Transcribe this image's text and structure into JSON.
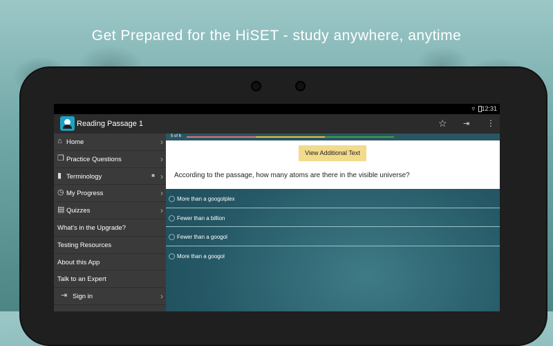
{
  "headline": "Get Prepared for the HiSET - study anywhere, anytime",
  "statusbar": {
    "time": "12:31",
    "wifi_icon": "wifi-icon",
    "battery_icon": "battery-icon"
  },
  "actionbar": {
    "title": "Reading Passage 1",
    "icons": [
      "star-icon",
      "sign-in-icon",
      "overflow-menu-icon"
    ]
  },
  "drawer": {
    "items": [
      {
        "label": "Home",
        "icon": "home-icon",
        "chevron": true
      },
      {
        "label": "Practice Questions",
        "icon": "copy-icon",
        "chevron": true
      },
      {
        "label": "Terminology",
        "icon": "book-icon",
        "chevron": true,
        "locked": true
      },
      {
        "label": "My Progress",
        "icon": "progress-icon",
        "chevron": true
      },
      {
        "label": "Quizzes",
        "icon": "quiz-icon",
        "chevron": true
      },
      {
        "label": "What's in the Upgrade?"
      },
      {
        "label": "Testing Resources"
      },
      {
        "label": "About this App"
      },
      {
        "label": "Talk to an Expert"
      },
      {
        "label": "Sign in",
        "icon": "sign-in-icon",
        "chevron": true
      }
    ]
  },
  "question": {
    "progress_label": "5 of 6",
    "progress": {
      "current": 5,
      "total": 6
    },
    "colors": {
      "seg1": "#e57373",
      "seg2": "#f2c230",
      "seg3": "#43a047"
    },
    "additional_text_button": "View Additional Text",
    "prompt": "According to the passage, how many atoms are there in the visible universe?",
    "answers": [
      "More than a googolplex",
      "Fewer than a billion",
      "Fewer than a googol",
      "More than a googol"
    ]
  }
}
